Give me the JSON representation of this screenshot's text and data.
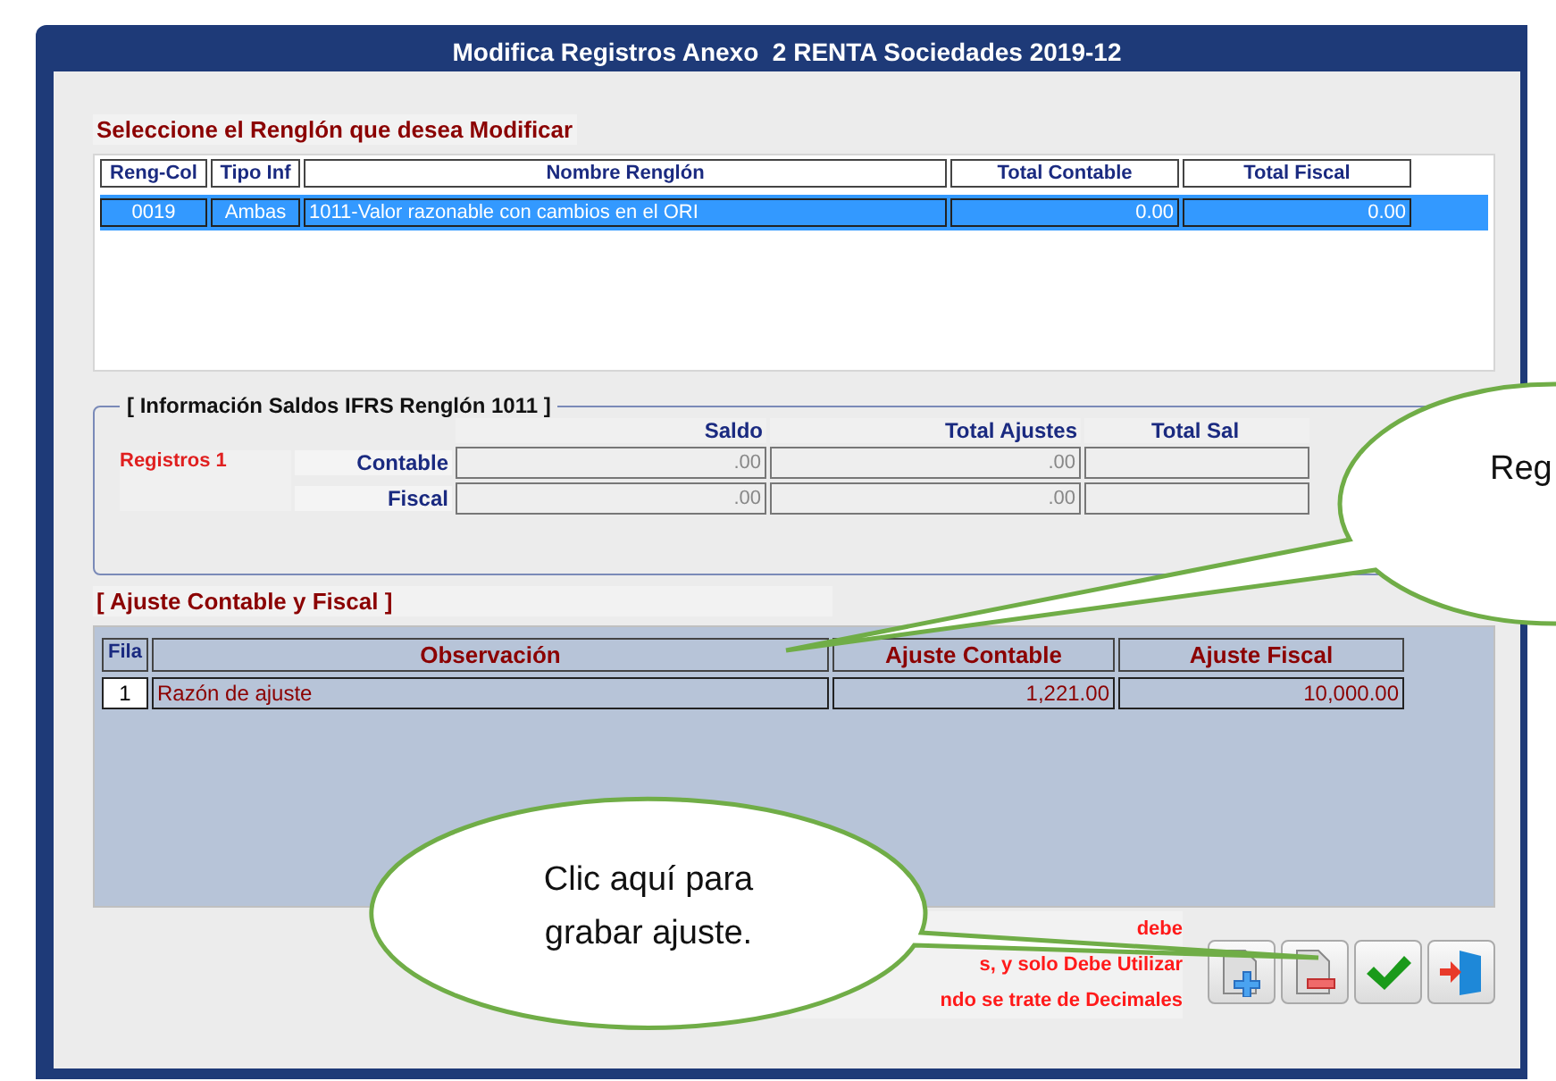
{
  "window": {
    "title": "Modifica Registros Anexo  2 RENTA Sociedades 2019-12"
  },
  "row_selector": {
    "heading": "Seleccione el Renglón que desea Modificar",
    "columns": [
      "Reng-Col",
      "Tipo Inf",
      "Nombre Renglón",
      "Total Contable",
      "Total Fiscal"
    ],
    "rows": [
      {
        "cells": [
          "0019",
          "Ambas",
          "1011-Valor razonable con cambios en el ORI",
          "0.00",
          "0.00"
        ],
        "selected": true
      }
    ]
  },
  "ifrs_info": {
    "title": "[ Información Saldos IFRS  Renglón 1011 ]",
    "columns": [
      "Saldo",
      "Total Ajustes",
      "Total Sal"
    ],
    "records_label": "Registros 1",
    "rows": [
      {
        "label": "Contable",
        "values": [
          ".00",
          ".00"
        ]
      },
      {
        "label": "Fiscal",
        "values": [
          ".00",
          ".00"
        ]
      }
    ]
  },
  "adjustments": {
    "heading": "[ Ajuste Contable y Fiscal ]",
    "columns": [
      "Fila",
      "Observación",
      "Ajuste Contable",
      "Ajuste Fiscal"
    ],
    "rows": [
      {
        "cells": [
          "1",
          "Razón de ajuste",
          "1,221.00",
          "10,000.00"
        ]
      }
    ]
  },
  "note": {
    "lines": [
      "debe",
      "s, y solo Debe Utilizar",
      "ndo se trate de Decimales"
    ]
  },
  "toolbar": [
    {
      "kind": "add"
    },
    {
      "kind": "remove"
    },
    {
      "kind": "save"
    },
    {
      "kind": "exit"
    }
  ],
  "callouts": [
    {
      "text": "Reg"
    },
    {
      "text": "Clic aquí para grabar ajuste."
    }
  ]
}
